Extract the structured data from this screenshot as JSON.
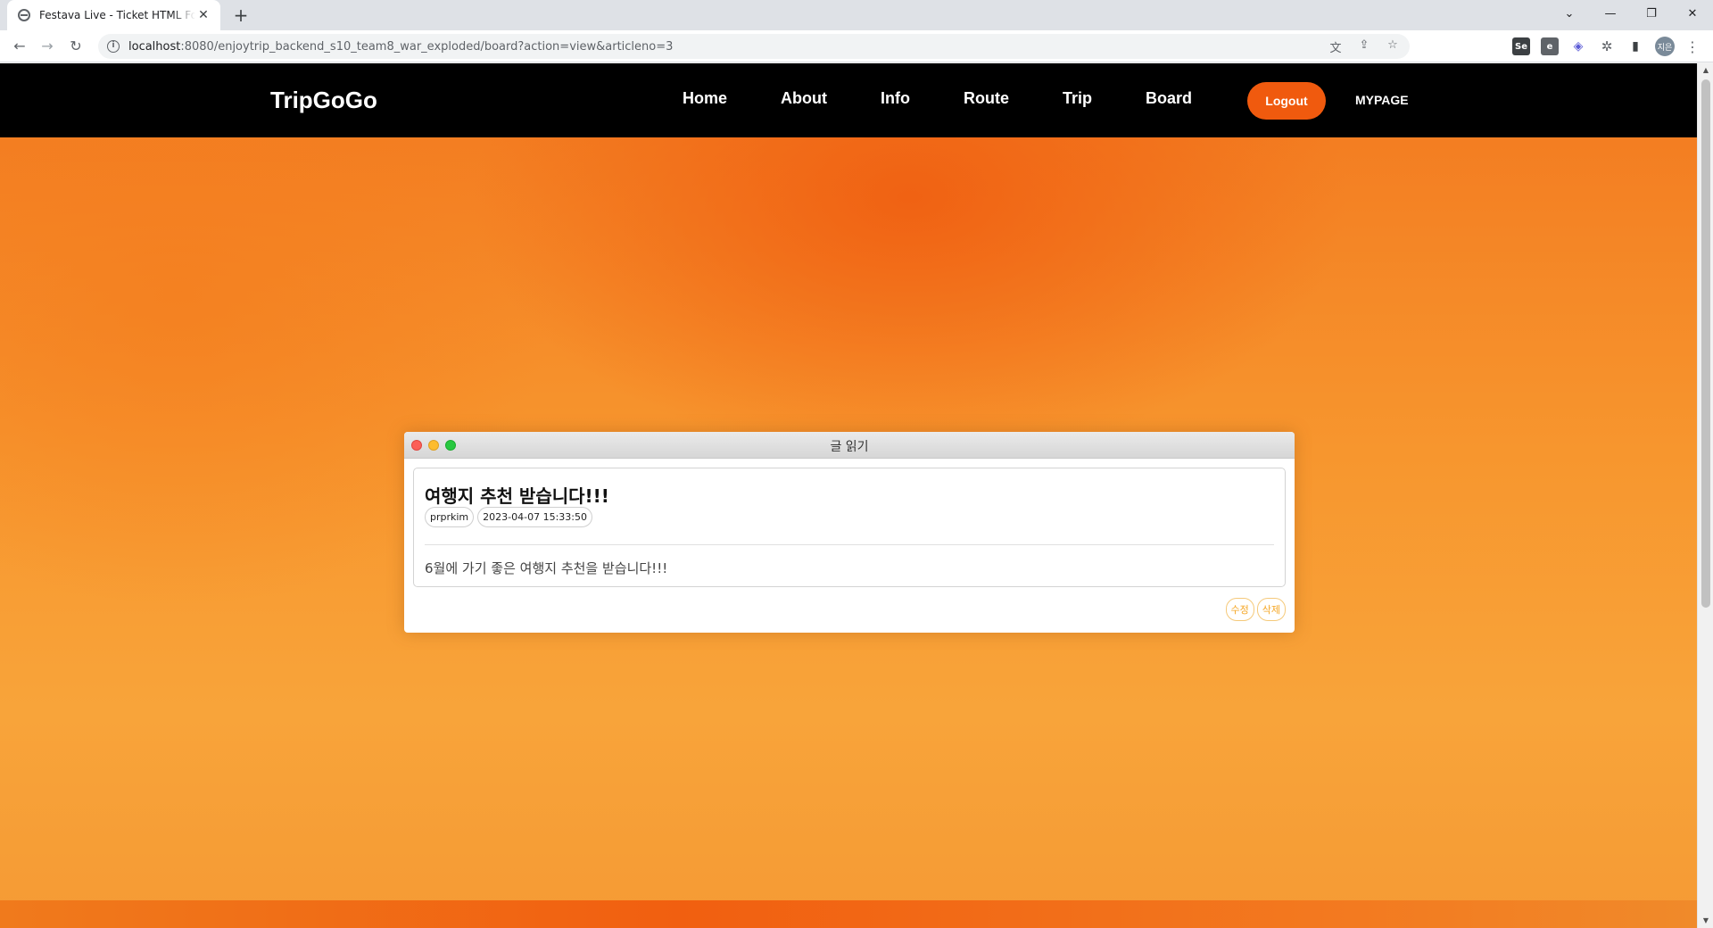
{
  "browser": {
    "tab_title": "Festava Live - Ticket HTML Form",
    "tab_close": "✕",
    "new_tab": "+",
    "url_host": "localhost",
    "url_path": ":8080/enjoytrip_backend_s10_team8_war_exploded/board?action=view&articleno=3",
    "window_controls": [
      "⌄",
      "—",
      "❐",
      "✕"
    ],
    "profile_label": "지은",
    "ext_labels": [
      "Se",
      "e",
      "◈",
      "✲",
      "▮"
    ]
  },
  "site": {
    "brand": "TripGoGo",
    "nav": [
      "Home",
      "About",
      "Info",
      "Route",
      "Trip",
      "Board"
    ],
    "logout_label": "Logout",
    "mypage_label": "MYPAGE"
  },
  "article_window": {
    "title": "글 읽기",
    "article_title": "여행지 추천 받습니다!!!",
    "author": "prprkim",
    "date": "2023-04-07 15:33:50",
    "body": "6월에 가기 좋은 여행지 추천을 받습니다!!!",
    "edit_label": "수정",
    "delete_label": "삭제"
  },
  "colors": {
    "accent": "#f05a0e",
    "nav_bg": "#000000",
    "action_text": "#f5a623"
  }
}
